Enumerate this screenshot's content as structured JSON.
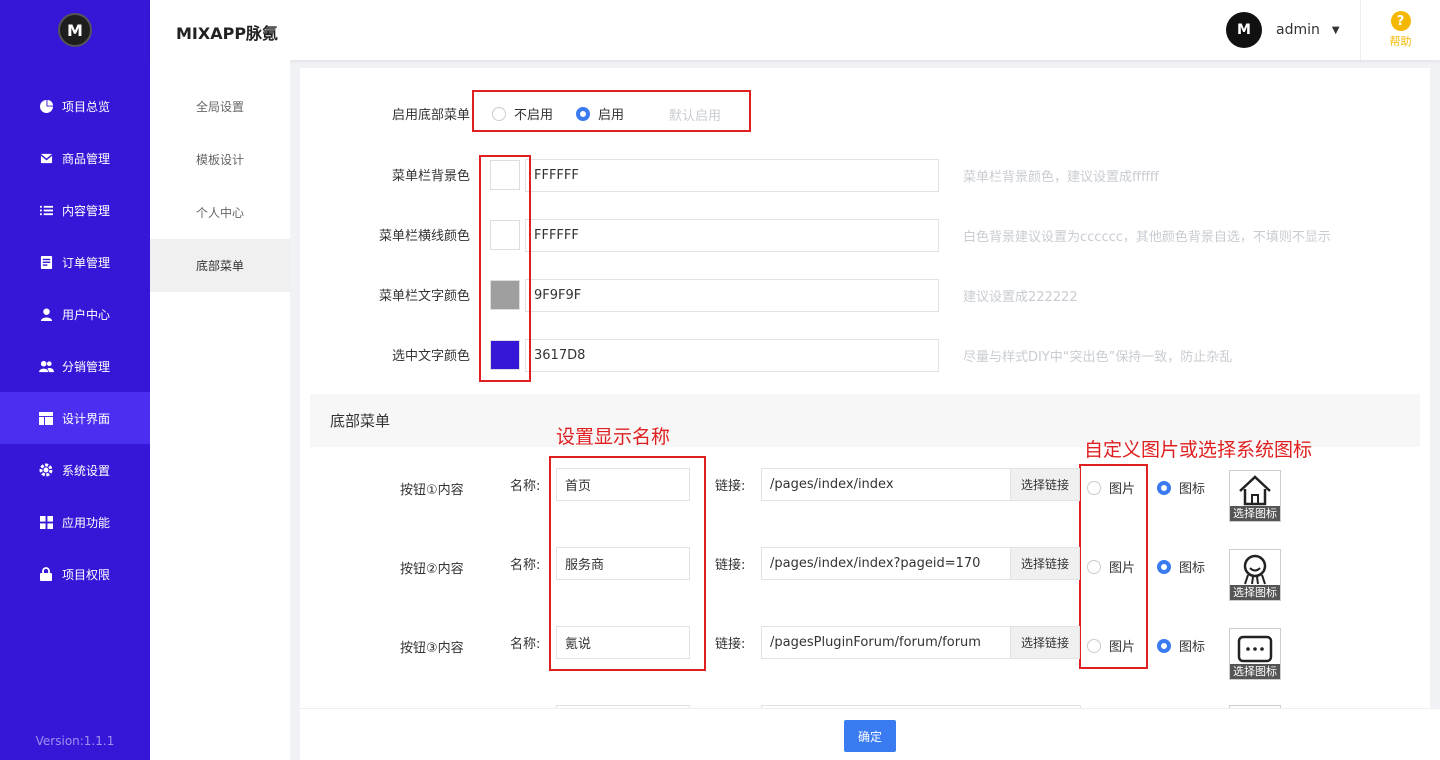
{
  "app": {
    "title": "MIXAPP脉氪",
    "version": "Version:1.1.1",
    "logo_text": "M"
  },
  "header": {
    "username": "admin",
    "avatar_text": "M",
    "help_label": "帮助"
  },
  "sidebar": {
    "items": [
      {
        "label": "项目总览",
        "icon": "pie-chart-icon"
      },
      {
        "label": "商品管理",
        "icon": "box-icon"
      },
      {
        "label": "内容管理",
        "icon": "list-icon"
      },
      {
        "label": "订单管理",
        "icon": "document-icon"
      },
      {
        "label": "用户中心",
        "icon": "user-icon"
      },
      {
        "label": "分销管理",
        "icon": "users-icon"
      },
      {
        "label": "设计界面",
        "icon": "layout-icon"
      },
      {
        "label": "系统设置",
        "icon": "gear-icon"
      },
      {
        "label": "应用功能",
        "icon": "grid-icon"
      },
      {
        "label": "项目权限",
        "icon": "lock-icon"
      }
    ],
    "active": "设计界面"
  },
  "subnav": {
    "items": [
      "全局设置",
      "模板设计",
      "个人中心",
      "底部菜单"
    ],
    "active": "底部菜单"
  },
  "form": {
    "enable_label": "启用底部菜单",
    "enable_options": [
      "不启用",
      "启用"
    ],
    "enable_selected": "启用",
    "enable_hint": "默认启用",
    "colors": [
      {
        "label": "菜单栏背景色",
        "value": "FFFFFF",
        "swatch": "#FFFFFF",
        "hint": "菜单栏背景颜色，建议设置成ffffff"
      },
      {
        "label": "菜单栏横线颜色",
        "value": "FFFFFF",
        "swatch": "#FFFFFF",
        "hint": "白色背景建议设置为cccccc，其他颜色背景自选，不填则不显示"
      },
      {
        "label": "菜单栏文字颜色",
        "value": "9F9F9F",
        "swatch": "#9F9F9F",
        "hint": "建议设置成222222"
      },
      {
        "label": "选中文字颜色",
        "value": "3617D8",
        "swatch": "#3617D8",
        "hint": "尽量与样式DIY中“突出色”保持一致，防止杂乱"
      }
    ],
    "section_title": "底部菜单",
    "annotation_name": "设置显示名称",
    "annotation_icon": "自定义图片或选择系统图标",
    "name_label": "名称:",
    "link_label": "链接:",
    "choose_link": "选择链接",
    "image_option": "图片",
    "icon_option": "图标",
    "choose_icon": "选择图标",
    "buttons": [
      {
        "label": "按钮①内容",
        "name": "首页",
        "link": "/pages/index/index",
        "icon": "home-icon"
      },
      {
        "label": "按钮②内容",
        "name": "服务商",
        "link": "/pages/index/index?pageid=170",
        "icon": "service-person-icon"
      },
      {
        "label": "按钮③内容",
        "name": "氪说",
        "link": "/pagesPluginForum/forum/forum",
        "icon": "chat-bubble-icon"
      }
    ]
  },
  "footer": {
    "confirm": "确定"
  },
  "colors": {
    "brand": "#3617D8",
    "primary": "#3a7bf2",
    "annotation": "#e02020"
  }
}
